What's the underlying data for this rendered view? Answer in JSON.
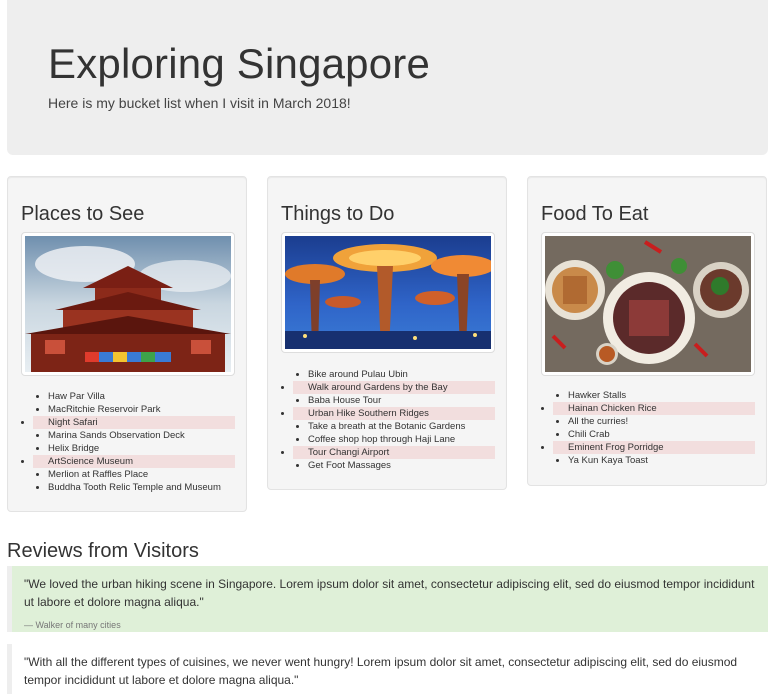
{
  "header": {
    "title": "Exploring Singapore",
    "subtitle": "Here is my bucket list when I visit in March 2018!"
  },
  "cards": [
    {
      "title": "Places to See",
      "image": "temple-photo",
      "items": [
        {
          "text": "Haw Par Villa",
          "highlight": false
        },
        {
          "text": "MacRitchie Reservoir Park",
          "highlight": false
        },
        {
          "text": "Night Safari",
          "highlight": true
        },
        {
          "text": "Marina Sands Observation Deck",
          "highlight": false
        },
        {
          "text": "Helix Bridge",
          "highlight": false
        },
        {
          "text": "ArtScience Museum",
          "highlight": true
        },
        {
          "text": "Merlion at Raffles Place",
          "highlight": false
        },
        {
          "text": "Buddha Tooth Relic Temple and Museum",
          "highlight": false
        }
      ]
    },
    {
      "title": "Things to Do",
      "image": "supertree-grove-photo",
      "items": [
        {
          "text": "Bike around Pulau Ubin",
          "highlight": false
        },
        {
          "text": "Walk around Gardens by the Bay",
          "highlight": true
        },
        {
          "text": "Baba House Tour",
          "highlight": false
        },
        {
          "text": "Urban Hike Southern Ridges",
          "highlight": true
        },
        {
          "text": "Take a breath at the Botanic Gardens",
          "highlight": false
        },
        {
          "text": "Coffee shop hop through Haji Lane",
          "highlight": false
        },
        {
          "text": "Tour Changi Airport",
          "highlight": true
        },
        {
          "text": "Get Foot Massages",
          "highlight": false
        }
      ]
    },
    {
      "title": "Food To Eat",
      "image": "food-plates-photo",
      "items": [
        {
          "text": "Hawker Stalls",
          "highlight": false
        },
        {
          "text": "Hainan Chicken Rice",
          "highlight": true
        },
        {
          "text": "All the curries!",
          "highlight": false
        },
        {
          "text": "Chili Crab",
          "highlight": false
        },
        {
          "text": "Eminent Frog Porridge",
          "highlight": true
        },
        {
          "text": "Ya Kun Kaya Toast",
          "highlight": false
        }
      ]
    }
  ],
  "reviews": {
    "title": "Reviews from Visitors",
    "items": [
      {
        "quote": "\"We loved the urban hiking scene in Singapore. Lorem ipsum dolor sit amet, consectetur adipiscing elit, sed do eiusmod tempor incididunt ut labore et dolore magna aliqua.\"",
        "author": "— Walker of many cities"
      },
      {
        "quote": "\"With all the different types of cuisines, we never went hungry! Lorem ipsum dolor sit amet, consectetur adipiscing elit, sed do eiusmod tempor incididunt ut labore et dolore magna aliqua.\""
      }
    ]
  },
  "colors": {
    "jumbotron_bg": "#eeeeee",
    "card_bg": "#f5f5f5",
    "highlight_bg": "#f2dede",
    "review_green_bg": "#dff0d8"
  }
}
